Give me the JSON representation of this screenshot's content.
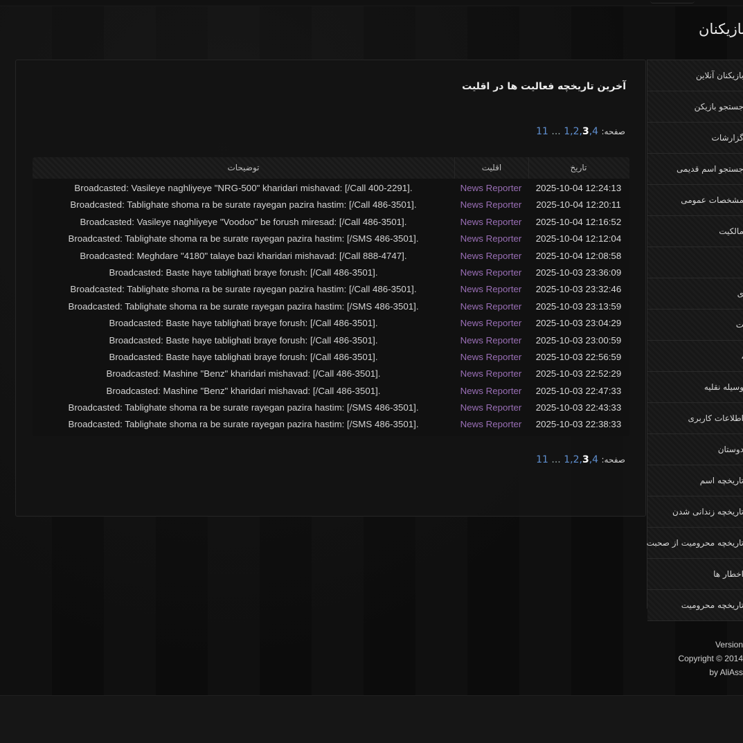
{
  "site": {
    "title": "بازیکنان"
  },
  "sidebar": {
    "items": [
      {
        "label": "بازیکنان آنلاین"
      },
      {
        "label": "جستجو بازیکن"
      },
      {
        "label": "گزارشات"
      },
      {
        "label": "جستجو اسم قدیمی"
      },
      {
        "label": "مشخصات عمومی"
      },
      {
        "label": "مالکیت"
      },
      {
        "label": ""
      },
      {
        "label": "ی"
      },
      {
        "label": "ت"
      },
      {
        "label": "،"
      },
      {
        "label": "وسیله نقلیه"
      },
      {
        "label": "اطلاعات کاربری"
      },
      {
        "label": "دوستان"
      },
      {
        "label": "تاریخچه اسم"
      },
      {
        "label": "تاریخچه زندانی شدن"
      },
      {
        "label": "تاریخچه محرومیت از صحبت"
      },
      {
        "label": "اخطار ها"
      },
      {
        "label": "تاریخچه محرومیت"
      }
    ]
  },
  "main": {
    "title": "آخرین تاریخچه فعالیت ها در اقلیت",
    "pager": {
      "label": "صفحه:",
      "pages": [
        "1",
        "2",
        "3",
        "4",
        "...",
        "11"
      ],
      "current": "3"
    },
    "table": {
      "headers": {
        "date": "تاریخ",
        "minority": "اقلیت",
        "description": "توضیحات"
      },
      "rows": [
        {
          "date": "2025-10-04 12:24:13",
          "minority": "News Reporter",
          "description": "Broadcasted: Vasileye naghliyeye \"NRG-500\" kharidari mishavad: [/Call 400-2291]."
        },
        {
          "date": "2025-10-04 12:20:11",
          "minority": "News Reporter",
          "description": "Broadcasted: Tablighate shoma ra be surate rayegan pazira hastim: [/Call 486-3501]."
        },
        {
          "date": "2025-10-04 12:16:52",
          "minority": "News Reporter",
          "description": "Broadcasted: Vasileye naghliyeye \"Voodoo\" be forush miresad: [/Call 486-3501]."
        },
        {
          "date": "2025-10-04 12:12:04",
          "minority": "News Reporter",
          "description": "Broadcasted: Tablighate shoma ra be surate rayegan pazira hastim: [/SMS 486-3501]."
        },
        {
          "date": "2025-10-04 12:08:58",
          "minority": "News Reporter",
          "description": "Broadcasted: Meghdare \"4180\" talaye bazi kharidari mishavad: [/Call 888-4747]."
        },
        {
          "date": "2025-10-03 23:36:09",
          "minority": "News Reporter",
          "description": "Broadcasted: Baste haye tablighati braye forush: [/Call 486-3501]."
        },
        {
          "date": "2025-10-03 23:32:46",
          "minority": "News Reporter",
          "description": "Broadcasted: Tablighate shoma ra be surate rayegan pazira hastim: [/Call 486-3501]."
        },
        {
          "date": "2025-10-03 23:13:59",
          "minority": "News Reporter",
          "description": "Broadcasted: Tablighate shoma ra be surate rayegan pazira hastim: [/SMS 486-3501]."
        },
        {
          "date": "2025-10-03 23:04:29",
          "minority": "News Reporter",
          "description": "Broadcasted: Baste haye tablighati braye forush: [/Call 486-3501]."
        },
        {
          "date": "2025-10-03 23:00:59",
          "minority": "News Reporter",
          "description": "Broadcasted: Baste haye tablighati braye forush: [/Call 486-3501]."
        },
        {
          "date": "2025-10-03 22:56:59",
          "minority": "News Reporter",
          "description": "Broadcasted: Baste haye tablighati braye forush: [/Call 486-3501]."
        },
        {
          "date": "2025-10-03 22:52:29",
          "minority": "News Reporter",
          "description": "Broadcasted: Mashine \"Benz\" kharidari mishavad: [/Call 486-3501]."
        },
        {
          "date": "2025-10-03 22:47:33",
          "minority": "News Reporter",
          "description": "Broadcasted: Mashine \"Benz\" kharidari mishavad: [/Call 486-3501]."
        },
        {
          "date": "2025-10-03 22:43:33",
          "minority": "News Reporter",
          "description": "Broadcasted: Tablighate shoma ra be surate rayegan pazira hastim: [/SMS 486-3501]."
        },
        {
          "date": "2025-10-03 22:38:33",
          "minority": "News Reporter",
          "description": "Broadcasted: Tablighate shoma ra be surate rayegan pazira hastim: [/SMS 486-3501]."
        }
      ]
    }
  },
  "footer": {
    "version": "Version",
    "copyright": "Copyright © 2014",
    "author": "by AliAss"
  },
  "colors": {
    "link": "#5f8fd0",
    "minority": "#9a6fb6",
    "background": "#0d0d0d"
  }
}
